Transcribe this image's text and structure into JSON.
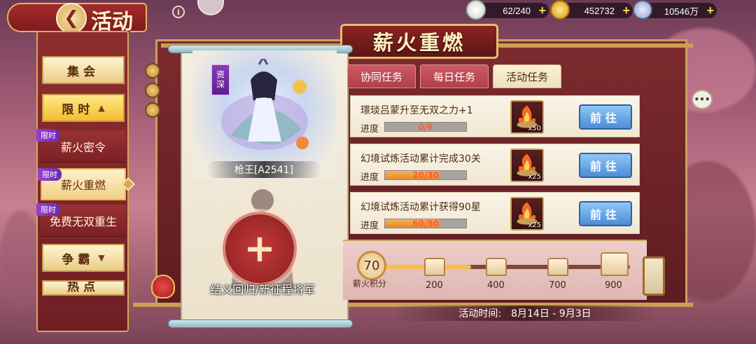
{
  "header": {
    "title": "活动",
    "back_icon": "back-arrow-icon",
    "info_icon_glyph": "i"
  },
  "currency": [
    {
      "icon": "dumpling-icon",
      "value": "62/240"
    },
    {
      "icon": "gold-ingot-icon",
      "value": "452732"
    },
    {
      "icon": "silver-coin-icon",
      "value": "10546万"
    }
  ],
  "nav": {
    "items": [
      {
        "label": "集会"
      },
      {
        "label": "限时",
        "arrow": "▲"
      },
      {
        "label": "争霸",
        "arrow": "▼"
      },
      {
        "label": "热点"
      }
    ],
    "sub_items": [
      {
        "tag": "限时",
        "label": "薪火密令"
      },
      {
        "tag": "限时",
        "label": "薪火重燃"
      },
      {
        "tag": "限时",
        "label": "免费无双重生"
      }
    ]
  },
  "panel": {
    "title": "薪火重燃",
    "tabs": [
      "协同任务",
      "每日任务",
      "活动任务"
    ],
    "active_tab": 2
  },
  "hero": {
    "tag": "资深",
    "name": "枪王[A2541]",
    "recruit_plus": "+",
    "recruit_label": "结义回归/新征程将军"
  },
  "tasks": [
    {
      "title": "璟琰吕蒙升至无双之力+1",
      "progress_label": "进度",
      "progress_text": "0/6",
      "progress": 0.0,
      "reward_count": "x50",
      "button": "前往"
    },
    {
      "title": "幻境试炼活动累计完成30关",
      "progress_label": "进度",
      "progress_text": "20/30",
      "progress": 0.667,
      "reward_count": "x25",
      "button": "前往"
    },
    {
      "title": "幻境试炼活动累计获得90星",
      "progress_label": "进度",
      "progress_text": "60/90",
      "progress": 0.667,
      "reward_count": "x25",
      "button": "前往"
    }
  ],
  "points": {
    "value": "70",
    "label": "薪火积分",
    "progress": 0.35,
    "milestones": [
      "200",
      "400",
      "700",
      "900"
    ]
  },
  "event_time": {
    "label": "活动时间:",
    "range": "8月14日 - 9月3日"
  },
  "chat_glyph": "•••",
  "colors": {
    "accent_red": "#8a2323",
    "gold_border": "#e6bd6e",
    "button_blue": "#4d8cd9",
    "progress_orange": "#e48a2d",
    "limit_purple": "#7a2fc0"
  }
}
